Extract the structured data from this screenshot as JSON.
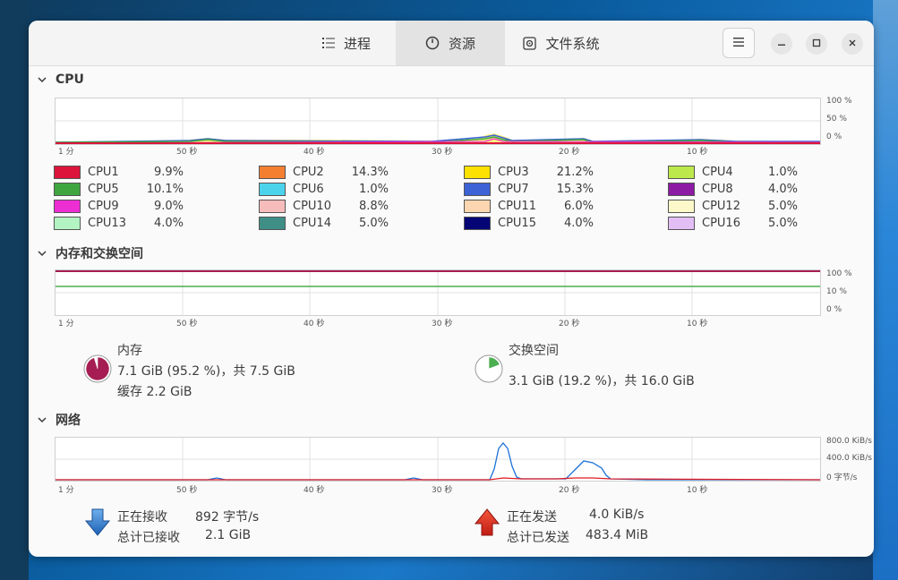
{
  "tabs": [
    {
      "label": "进程",
      "icon": "list-icon"
    },
    {
      "label": "资源",
      "icon": "gauge-icon"
    },
    {
      "label": "文件系统",
      "icon": "disk-icon"
    }
  ],
  "cpu": {
    "title": "CPU",
    "y_ticks": [
      "100 %",
      "50 %",
      "0 %"
    ],
    "x_ticks": [
      "1 分",
      "50 秒",
      "40 秒",
      "30 秒",
      "20 秒",
      "10 秒"
    ],
    "cores": [
      {
        "name": "CPU1",
        "pct": "9.9%",
        "color": "#dc143c"
      },
      {
        "name": "CPU2",
        "pct": "14.3%",
        "color": "#f57f31"
      },
      {
        "name": "CPU3",
        "pct": "21.2%",
        "color": "#fde100"
      },
      {
        "name": "CPU4",
        "pct": "1.0%",
        "color": "#bde84c"
      },
      {
        "name": "CPU5",
        "pct": "10.1%",
        "color": "#3fa63f"
      },
      {
        "name": "CPU6",
        "pct": "1.0%",
        "color": "#4cd3ec"
      },
      {
        "name": "CPU7",
        "pct": "15.3%",
        "color": "#3d62d6"
      },
      {
        "name": "CPU8",
        "pct": "4.0%",
        "color": "#8c1aa3"
      },
      {
        "name": "CPU9",
        "pct": "9.0%",
        "color": "#ec2ed3"
      },
      {
        "name": "CPU10",
        "pct": "8.8%",
        "color": "#f6bcbc"
      },
      {
        "name": "CPU11",
        "pct": "6.0%",
        "color": "#fcd6b0"
      },
      {
        "name": "CPU12",
        "pct": "5.0%",
        "color": "#fdf8c9"
      },
      {
        "name": "CPU13",
        "pct": "4.0%",
        "color": "#b3f4c3"
      },
      {
        "name": "CPU14",
        "pct": "5.0%",
        "color": "#3f8f87"
      },
      {
        "name": "CPU15",
        "pct": "4.0%",
        "color": "#050576"
      },
      {
        "name": "CPU16",
        "pct": "5.0%",
        "color": "#e3bef5"
      }
    ]
  },
  "memory": {
    "title": "内存和交换空间",
    "y_ticks": [
      "100 %",
      "10 %",
      "0 %"
    ],
    "x_ticks": [
      "1 分",
      "50 秒",
      "40 秒",
      "30 秒",
      "20 秒",
      "10 秒"
    ],
    "mem_label": "内存",
    "mem_detail": "7.1 GiB (95.2 %)，共 7.5 GiB",
    "mem_cache": "缓存 2.2 GiB",
    "mem_fraction": 0.952,
    "mem_color": "#a51d52",
    "swap_label": "交换空间",
    "swap_detail": "3.1 GiB (19.2 %)，共 16.0 GiB",
    "swap_fraction": 0.192,
    "swap_color": "#4caf50"
  },
  "network": {
    "title": "网络",
    "y_ticks": [
      "800.0 KiB/s",
      "400.0 KiB/s",
      "0 字节/s"
    ],
    "x_ticks": [
      "1 分",
      "50 秒",
      "40 秒",
      "30 秒",
      "20 秒",
      "10 秒"
    ],
    "recv_label": "正在接收",
    "recv_rate": "892 字节/s",
    "recv_total_label": "总计已接收",
    "recv_total": "2.1 GiB",
    "send_label": "正在发送",
    "send_rate": "4.0 KiB/s",
    "send_total_label": "总计已发送",
    "send_total": "483.4 MiB",
    "recv_color": "#1c71d8",
    "send_color": "#e01b24"
  }
}
